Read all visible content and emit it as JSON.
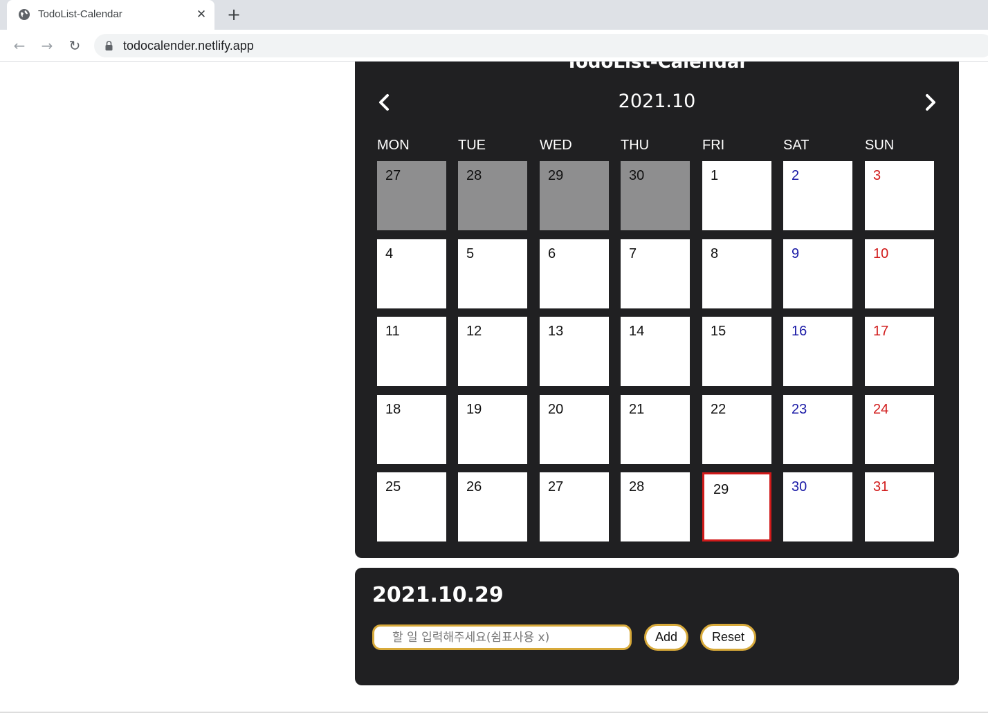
{
  "browser": {
    "tab_title": "TodoList-Calendar",
    "url": "todocalender.netlify.app",
    "icons": {
      "tab": "globe-icon",
      "close": "close-icon",
      "new_tab": "plus-icon",
      "back": "arrow-left-icon",
      "forward": "arrow-right-icon",
      "reload": "reload-icon",
      "lock": "lock-icon"
    }
  },
  "calendar": {
    "page_title": "TodoList-Calendar",
    "month_label": "2021.10",
    "weekdays": [
      "MON",
      "TUE",
      "WED",
      "THU",
      "FRI",
      "SAT",
      "SUN"
    ],
    "weeks": [
      [
        "27",
        "28",
        "29",
        "30",
        "1",
        "2",
        "3"
      ],
      [
        "4",
        "5",
        "6",
        "7",
        "8",
        "9",
        "10"
      ],
      [
        "11",
        "12",
        "13",
        "14",
        "15",
        "16",
        "17"
      ],
      [
        "18",
        "19",
        "20",
        "21",
        "22",
        "23",
        "24"
      ],
      [
        "25",
        "26",
        "27",
        "28",
        "29",
        "30",
        "31"
      ]
    ],
    "prev_month_days": 4,
    "selected_day": "29",
    "colors": {
      "panel_bg": "#202022",
      "prev_month_cell": "#8e8e8f",
      "saturday": "#1a1aa6",
      "sunday": "#d11a1a",
      "today_border": "#d11a1a",
      "accent_border": "#d7a93a"
    }
  },
  "todo": {
    "selected_date": "2021.10.29",
    "input_placeholder": "할 일 입력해주세요(쉼표사용 x)",
    "input_value": "",
    "add_label": "Add",
    "reset_label": "Reset"
  }
}
